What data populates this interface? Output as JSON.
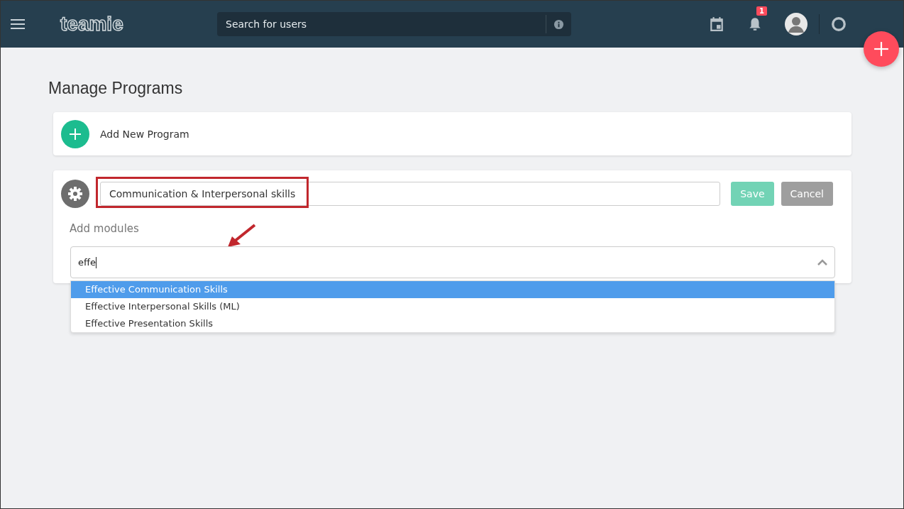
{
  "header": {
    "logo": "teamie",
    "search": {
      "placeholder": "Search for users"
    },
    "notifications": {
      "count": "1"
    }
  },
  "page": {
    "title": "Manage Programs"
  },
  "add_program": {
    "label": "Add New Program"
  },
  "program_editor": {
    "name_value": "Communication & Interpersonal skills",
    "name_highlighted": true,
    "save": {
      "label": "Save",
      "disabled": true
    },
    "cancel": {
      "label": "Cancel"
    },
    "modules_label": "Add modules",
    "modules_search": {
      "value": "effe",
      "expanded": true
    },
    "options": [
      {
        "label": "Effective Communication Skills",
        "selected": true
      },
      {
        "label": "Effective Interpersonal Skills (ML)",
        "selected": false
      },
      {
        "label": "Effective Presentation Skills",
        "selected": false
      }
    ]
  }
}
